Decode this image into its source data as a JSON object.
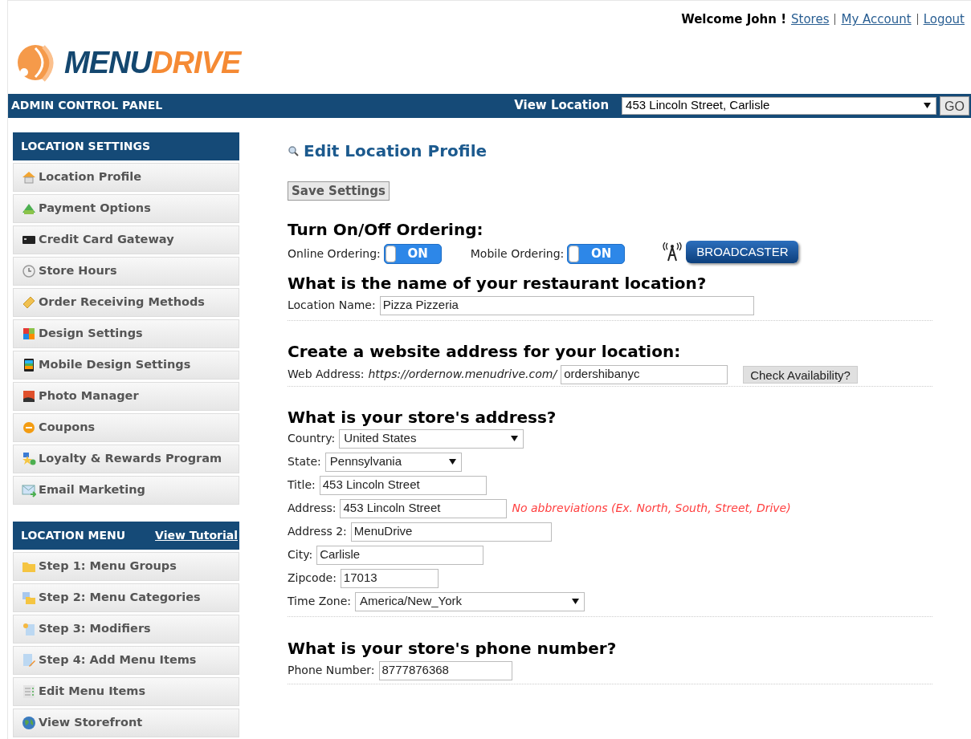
{
  "header": {
    "welcome": "Welcome John !",
    "links": [
      "Stores",
      "My Account",
      "Logout"
    ],
    "logo": {
      "part1": "MENU",
      "part2": "DRIVE"
    }
  },
  "topbar": {
    "title": "ADMIN CONTROL PANEL",
    "view_label": "View Location",
    "location": "453 Lincoln Street, Carlisle",
    "go": "GO"
  },
  "sidebar": [
    {
      "title": "LOCATION SETTINGS",
      "items": [
        "Location Profile",
        "Payment Options",
        "Credit Card Gateway",
        "Store Hours",
        "Order Receiving Methods",
        "Design Settings",
        "Mobile Design Settings",
        "Photo Manager",
        "Coupons",
        "Loyalty & Rewards Program",
        "Email Marketing"
      ]
    },
    {
      "title": "LOCATION MENU",
      "link": "View Tutorial",
      "items": [
        "Step 1: Menu Groups",
        "Step 2: Menu Categories",
        "Step 3: Modifiers",
        "Step 4: Add Menu Items",
        "Edit Menu Items",
        "View Storefront"
      ]
    }
  ],
  "main": {
    "title": "Edit Location Profile",
    "save": "Save Settings",
    "ordering": {
      "heading": "Turn On/Off Ordering:",
      "toggles": [
        {
          "label": "Online Ordering:",
          "text": "ON",
          "on": true
        },
        {
          "label": "Mobile Ordering:",
          "text": "ON",
          "on": true
        }
      ],
      "broadcaster": "BROADCASTER"
    },
    "name_section": {
      "heading": "What is the name of your restaurant location?",
      "label": "Location Name:",
      "value": "Pizza Pizzeria"
    },
    "web_section": {
      "heading": "Create a website address for your location:",
      "label": "Web Address:",
      "prefix": "https://ordernow.menudrive.com/",
      "value": "ordershibanyc",
      "button": "Check Availability?"
    },
    "address_section": {
      "heading": "What is your store's address?",
      "fields": [
        {
          "kind": "select",
          "label": "Country:",
          "value": "United States"
        },
        {
          "kind": "select",
          "label": "State:",
          "value": "Pennsylvania"
        },
        {
          "kind": "text",
          "label": "Title:",
          "value": "453 Lincoln Street"
        },
        {
          "kind": "text",
          "label": "Address:",
          "value": "453 Lincoln Street",
          "note": "No abbreviations (Ex. North, South, Street, Drive)"
        },
        {
          "kind": "text",
          "label": "Address 2:",
          "value": "MenuDrive"
        },
        {
          "kind": "text",
          "label": "City:",
          "value": "Carlisle"
        },
        {
          "kind": "text",
          "label": "Zipcode:",
          "value": "17013"
        },
        {
          "kind": "select",
          "label": "Time Zone:",
          "value": "America/New_York"
        }
      ]
    },
    "phone_section": {
      "heading": "What is your store's phone number?",
      "label": "Phone Number:",
      "value": "8777876368"
    }
  }
}
